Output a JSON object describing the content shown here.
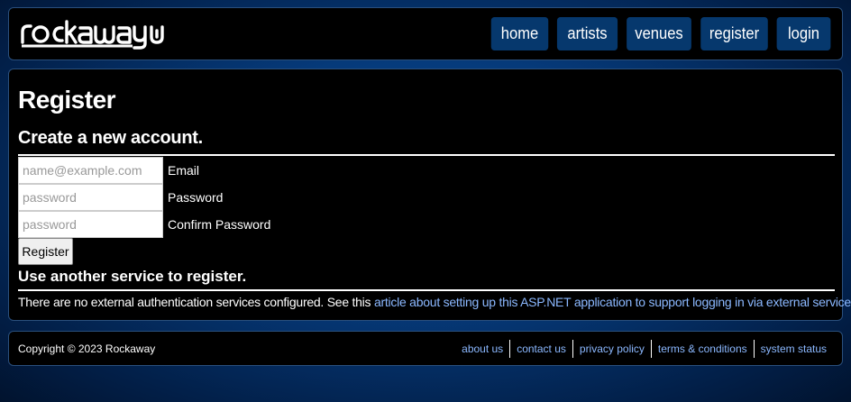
{
  "brand": {
    "logo_text": "rockaway"
  },
  "nav": {
    "items": [
      "home",
      "artists",
      "venues",
      "register",
      "login"
    ]
  },
  "main": {
    "title": "Register",
    "subtitle": "Create a new account.",
    "fields": {
      "email": {
        "placeholder": "name@example.com",
        "label": "Email"
      },
      "password": {
        "placeholder": "password",
        "label": "Password"
      },
      "confirm": {
        "placeholder": "password",
        "label": "Confirm Password"
      }
    },
    "register_button": "Register",
    "external_heading": "Use another service to register.",
    "external_text": "There are no external authentication services configured. See this ",
    "external_link": "article about setting up this ASP.NET application to support logging in via external services",
    "external_suffix": "."
  },
  "footer": {
    "copyright": "Copyright © 2023 Rockaway",
    "links": [
      "about us",
      "contact us",
      "privacy policy",
      "terms & conditions",
      "system status"
    ]
  },
  "colors": {
    "nav_button_bg": "#06386d",
    "link": "#8bb8ff",
    "panel_bg": "#000000"
  }
}
